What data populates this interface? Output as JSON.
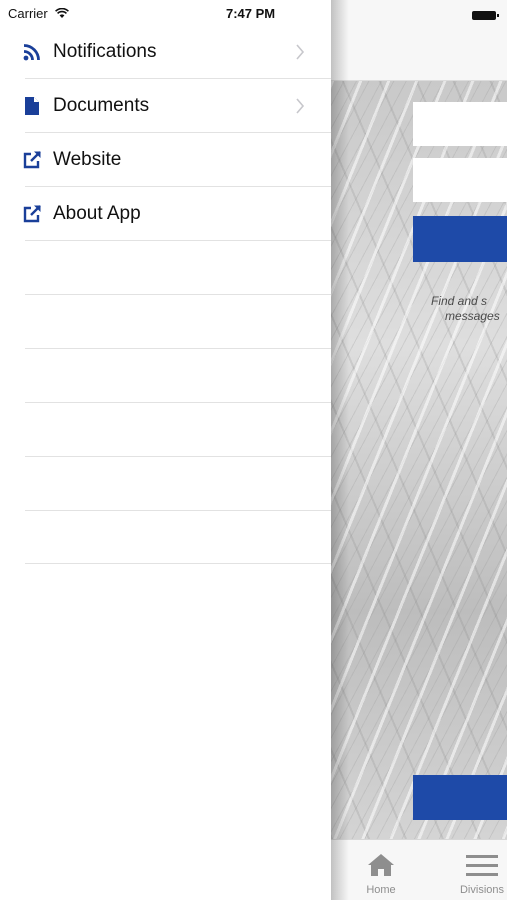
{
  "status_bar": {
    "carrier": "Carrier",
    "time": "7:47 PM",
    "wifi_icon": "wifi-icon",
    "battery_icon": "battery-icon"
  },
  "menu": {
    "items": [
      {
        "label": "Notifications",
        "icon": "rss-feed-icon",
        "has_chevron": true
      },
      {
        "label": "Documents",
        "icon": "document-icon",
        "has_chevron": true
      },
      {
        "label": "Website",
        "icon": "external-link-icon",
        "has_chevron": false
      },
      {
        "label": "About App",
        "icon": "external-link-icon",
        "has_chevron": false
      }
    ],
    "empty_rows": 6
  },
  "content": {
    "info_text_line1": "Find and s",
    "info_text_line2": "messages"
  },
  "tab_bar": {
    "tabs": [
      {
        "label": "Home",
        "icon": "home-icon"
      },
      {
        "label": "Divisions",
        "icon": "hamburger-menu-icon"
      }
    ]
  },
  "colors": {
    "accent_blue": "#1e4aa8",
    "menu_icon_blue": "#1a3f99",
    "tab_gray": "#8e8e8e"
  }
}
